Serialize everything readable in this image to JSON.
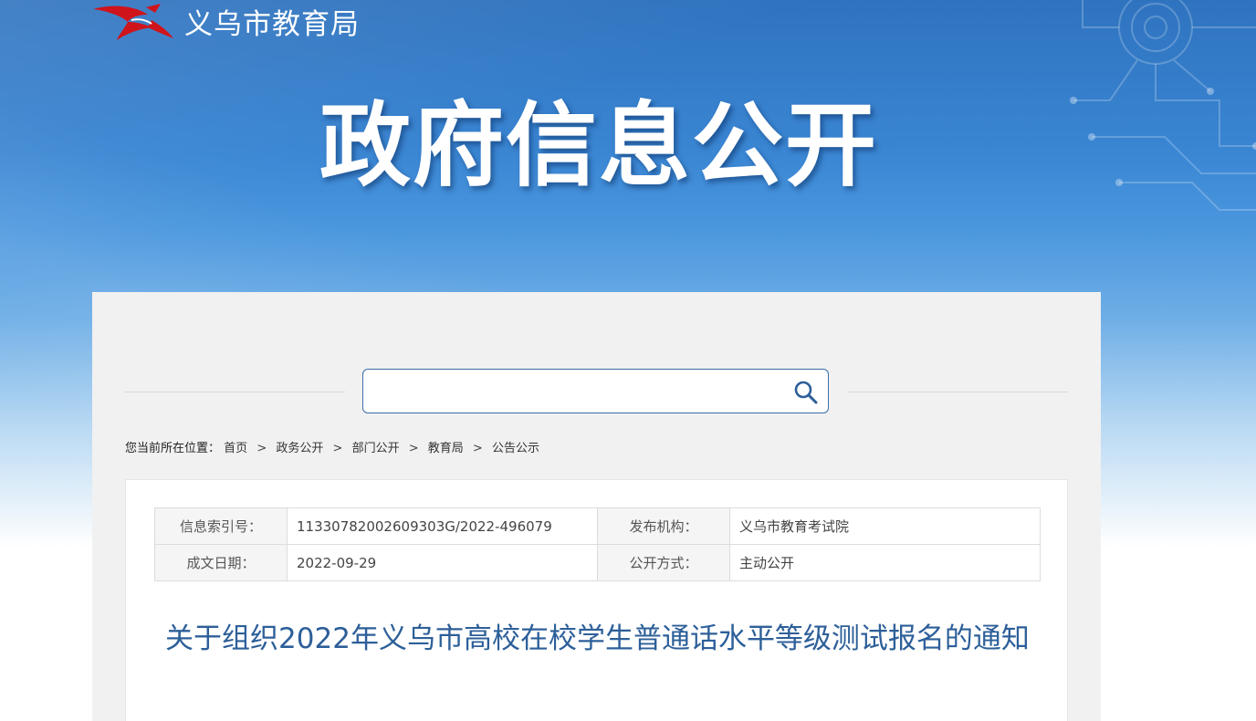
{
  "site": {
    "name": "义乌市教育局",
    "banner_title": "政府信息公开"
  },
  "search": {
    "value": "",
    "placeholder": ""
  },
  "breadcrumb": {
    "label": "您当前所在位置：",
    "items": [
      "首页",
      "政务公开",
      "部门公开",
      "教育局",
      "公告公示"
    ],
    "separator": ">"
  },
  "meta": {
    "index_label": "信息索引号：",
    "index_value": "11330782002609303G/2022-496079",
    "publisher_label": "发布机构：",
    "publisher_value": "义乌市教育考试院",
    "date_label": "成文日期：",
    "date_value": "2022-09-29",
    "mode_label": "公开方式：",
    "mode_value": "主动公开"
  },
  "document": {
    "title": "关于组织2022年义乌市高校在校学生普通话水平等级测试报名的通知"
  },
  "colors": {
    "banner_blue": "#3a86d3",
    "title_blue": "#2d5f99",
    "search_border": "#3a6ea8",
    "logo_red": "#d0141b"
  },
  "icons": {
    "logo": "swallow-logo-icon",
    "search": "search-icon"
  }
}
